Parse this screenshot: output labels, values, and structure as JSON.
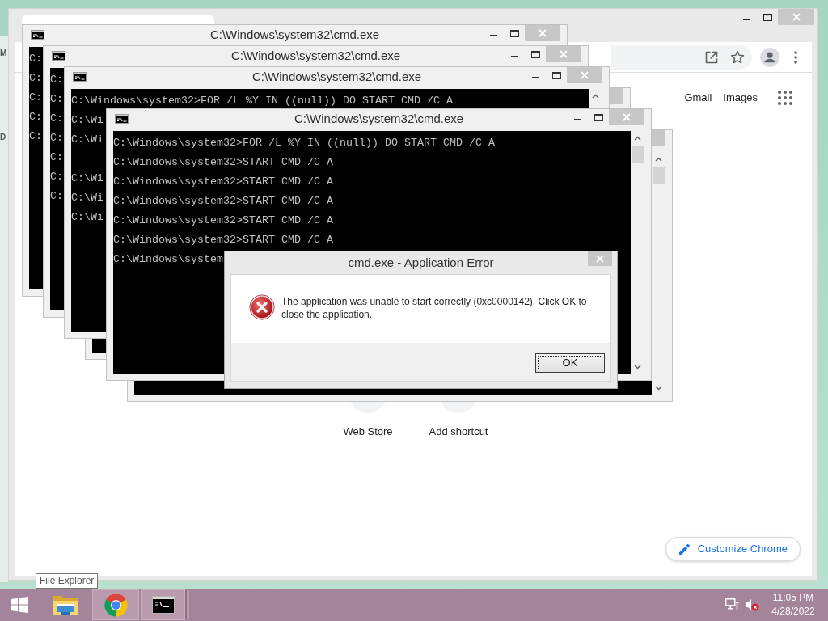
{
  "background_window": {
    "labels": [
      "M",
      "D"
    ]
  },
  "browser": {
    "header_links": [
      "Gmail",
      "Images"
    ],
    "shortcuts": [
      "Web Store",
      "Add shortcut"
    ],
    "customize_button": "Customize Chrome"
  },
  "console_windows": [
    {
      "kind": "window",
      "title": "C:\\Windows\\system32\\cmd.exe",
      "blocks": [
        [
          "C:",
          "C:",
          "C:",
          "C:",
          "C:"
        ]
      ]
    },
    {
      "kind": "window",
      "title": "C:\\Windows\\system32\\cmd.exe",
      "blocks": [
        [
          "C:",
          "C:",
          "C:",
          "C:",
          "C:",
          "C:",
          "C:"
        ]
      ]
    },
    {
      "kind": "window",
      "title": "C:\\Windows\\system32\\cmd.exe",
      "blocks": [
        [
          "C:\\Windows\\system32>FOR /L %Y IN ((null)) DO START CMD /C A",
          "C:\\Wi",
          "C:\\Wi"
        ],
        [
          "C:\\Wi",
          "C:\\Wi",
          "C:\\Wi"
        ]
      ]
    },
    {
      "kind": "window_edge"
    },
    {
      "kind": "window",
      "title": "C:\\Windows\\system32\\cmd.exe",
      "blocks": [
        [
          "C:\\Windows\\system32>FOR /L %Y IN ((null)) DO START CMD /C A",
          "C:\\Windows\\system32>START CMD /C A",
          "C:\\Windows\\system32>START CMD /C A",
          "C:\\Windows\\system32>START CMD /C A",
          "C:\\Windows\\system32>START CMD /C A",
          "C:\\Windows\\system32>START CMD /C A",
          "C:\\Windows\\system"
        ]
      ]
    },
    {
      "kind": "window_edge"
    }
  ],
  "dialog": {
    "title": "cmd.exe - Application Error",
    "message": "The application was unable to start correctly (0xc0000142). Click OK to close the application.",
    "ok_button": {
      "label": "OK",
      "focused": true
    }
  },
  "tooltip": "File Explorer",
  "taskbar": {
    "apps": [
      {
        "kind": "file_explorer",
        "running": false
      },
      {
        "kind": "browser",
        "running": true
      },
      {
        "kind": "console",
        "running": true,
        "stacked": true
      }
    ],
    "tray": {
      "volume": {
        "muted": true
      },
      "time": "11:05 PM",
      "date": "4/28/2022"
    }
  }
}
